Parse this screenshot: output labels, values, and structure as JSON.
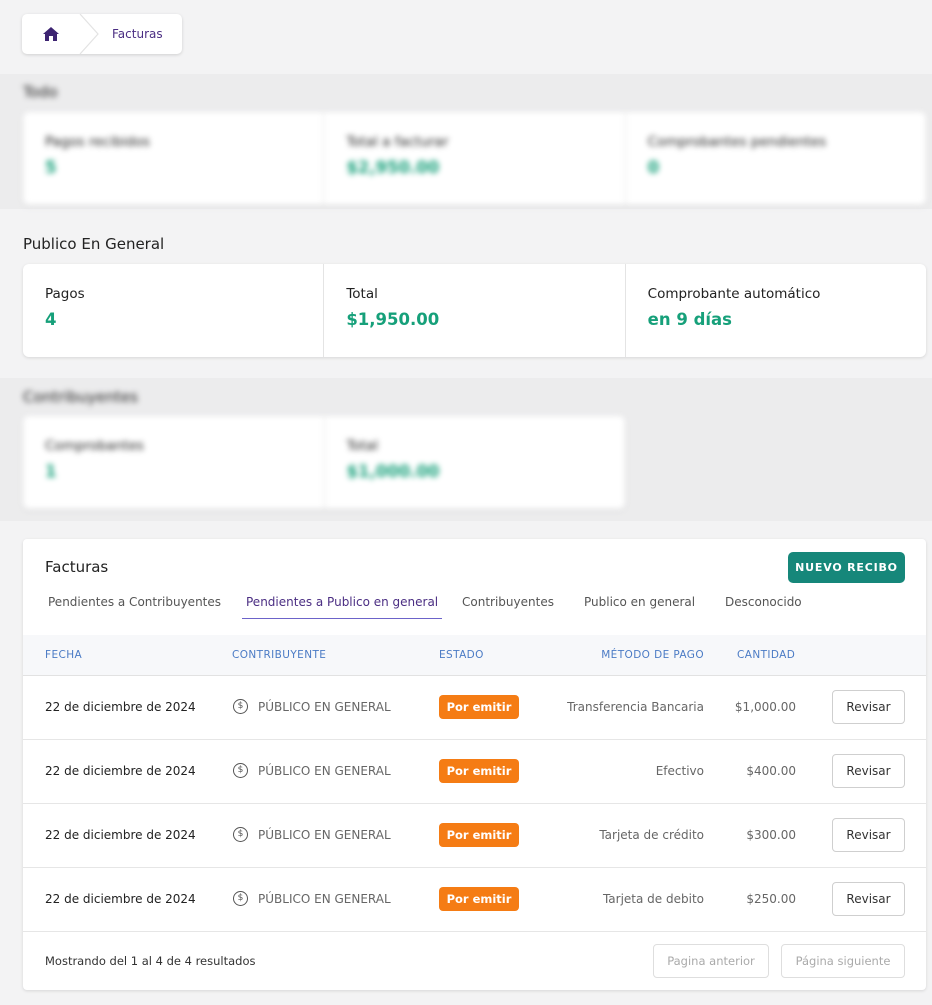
{
  "breadcrumb": {
    "home_icon": "home-icon",
    "label": "Facturas"
  },
  "todo": {
    "title": "Todo",
    "stats": [
      {
        "label": "Pagos recibidos",
        "value": "5"
      },
      {
        "label": "Total a facturar",
        "value": "$2,950.00"
      },
      {
        "label": "Comprobantes pendientes",
        "value": "0"
      }
    ]
  },
  "publico": {
    "title": "Publico En General",
    "stats": [
      {
        "label": "Pagos",
        "value": "4"
      },
      {
        "label": "Total",
        "value": "$1,950.00"
      },
      {
        "label": "Comprobante automático",
        "value": "en 9 días"
      }
    ]
  },
  "contribuyentes": {
    "title": "Contribuyentes",
    "stats": [
      {
        "label": "Comprobantes",
        "value": "1"
      },
      {
        "label": "Total",
        "value": "$1,000.00"
      }
    ]
  },
  "facturas": {
    "title": "Facturas",
    "new_button": "NUEVO RECIBO",
    "tabs": [
      "Pendientes a Contribuyentes",
      "Pendientes a Publico en general",
      "Contribuyentes",
      "Publico en general",
      "Desconocido"
    ],
    "active_tab": "Pendientes a Publico en general",
    "columns": [
      "FECHA",
      "CONTRIBUYENTE",
      "ESTADO",
      "MÉTODO DE PAGO",
      "CANTIDAD"
    ],
    "rows": [
      {
        "fecha": "22 de diciembre de 2024",
        "contribuyente": "PÚBLICO EN GENERAL",
        "estado": "Por emitir",
        "metodo": "Transferencia Bancaria",
        "cantidad": "$1,000.00",
        "action": "Revisar"
      },
      {
        "fecha": "22 de diciembre de 2024",
        "contribuyente": "PÚBLICO EN GENERAL",
        "estado": "Por emitir",
        "metodo": "Efectivo",
        "cantidad": "$400.00",
        "action": "Revisar"
      },
      {
        "fecha": "22 de diciembre de 2024",
        "contribuyente": "PÚBLICO EN GENERAL",
        "estado": "Por emitir",
        "metodo": "Tarjeta de crédito",
        "cantidad": "$300.00",
        "action": "Revisar"
      },
      {
        "fecha": "22 de diciembre de 2024",
        "contribuyente": "PÚBLICO EN GENERAL",
        "estado": "Por emitir",
        "metodo": "Tarjeta de debito",
        "cantidad": "$250.00",
        "action": "Revisar"
      }
    ],
    "footer": "Mostrando del 1 al 4 de 4 resultados",
    "prev_button": "Pagina anterior",
    "next_button": "Página siguiente"
  },
  "colors": {
    "accent": "#16877a",
    "value": "#16a07a",
    "badge": "#f57c14",
    "brand": "#4b2e83"
  }
}
